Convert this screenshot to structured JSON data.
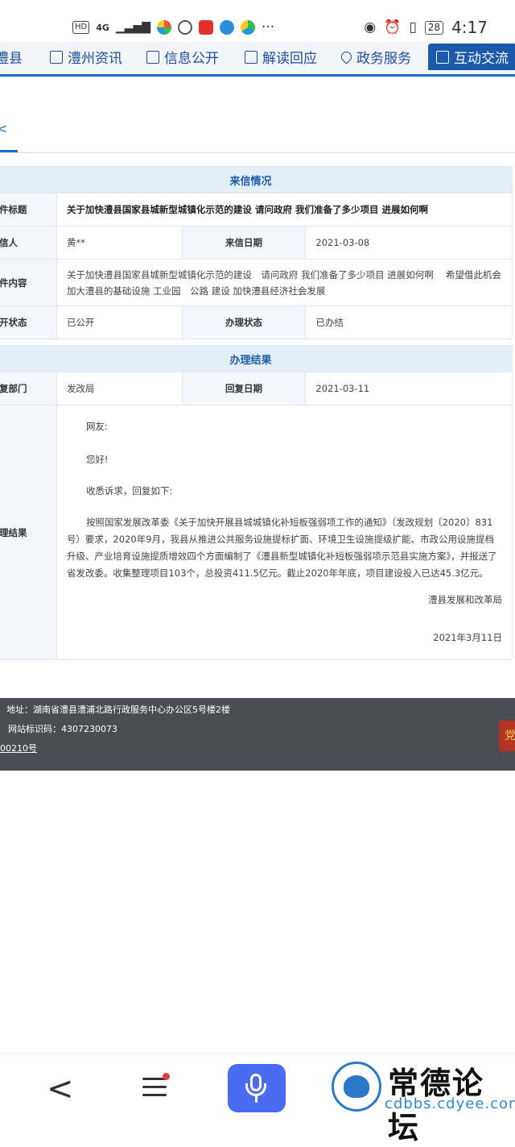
{
  "status_bar": {
    "hd": "HD",
    "network": "4G",
    "more": "···",
    "battery": "28",
    "time": "4:17"
  },
  "nav": {
    "items": [
      {
        "label": "澧县"
      },
      {
        "label": "澧州资讯"
      },
      {
        "label": "信息公开"
      },
      {
        "label": "解读回应"
      },
      {
        "label": "政务服务"
      },
      {
        "label": "互动交流"
      }
    ]
  },
  "tab": {
    "partial": "<"
  },
  "letter": {
    "section_title": "来信情况",
    "subject_label": "件标题",
    "subject": "关于加快澧县国家县城新型城镇化示范的建设 请问政府 我们准备了多少项目 进展如何啊",
    "sender_label": "信人",
    "sender": "黄**",
    "date_label": "来信日期",
    "date": "2021-03-08",
    "content_label": "件内容",
    "content": "关于加快澧县国家县城新型城镇化示范的建设　请问政府 我们准备了多少项目 进展如何啊　 希望借此机会加大澧县的基础设施 工业园　公路 建设 加快澧县经济社会发展",
    "public_label": "开状态",
    "public_status": "已公开",
    "process_label": "办理状态",
    "process_status": "已办结"
  },
  "result": {
    "section_title": "办理结果",
    "dept_label": "复部门",
    "dept": "发改局",
    "reply_date_label": "回复日期",
    "reply_date": "2021-03-11",
    "result_label": "理结果",
    "greeting": "网友:",
    "hello": "您好!",
    "intro": "收悉诉求，回复如下:",
    "body": "按照国家发展改革委《关于加快开展县城城镇化补短板强弱项工作的通知》（发改规划〔2020〕831号）要求，2020年9月，我县从推进公共服务设施提标扩面、环境卫生设施提级扩能、市政公用设施提档升级、产业培育设施提质增效四个方面编制了《澧县新型城镇化补短板强弱项示范县实施方案》，并报送了省发改委。收集整理项目103个，总投资411.5亿元。截止2020年年底，项目建设投入已达45.3亿元。",
    "signature": "澧县发展和改革局",
    "sign_date": "2021年3月11日"
  },
  "footer": {
    "address": "地址：湖南省澧县澧浦北路行政服务中心办公区5号楼2楼",
    "site_code": "网站标识码：4307230073",
    "record": "00210号",
    "emblem": "党"
  },
  "bottom_bar": {
    "back": "<",
    "watermark_title": "常德论坛",
    "watermark_url": "cdbbs.cdyee.com"
  },
  "colors": {
    "accent": "#1f6fc0",
    "mic": "#4a6cf0",
    "footer_bg": "#4a4e54"
  }
}
